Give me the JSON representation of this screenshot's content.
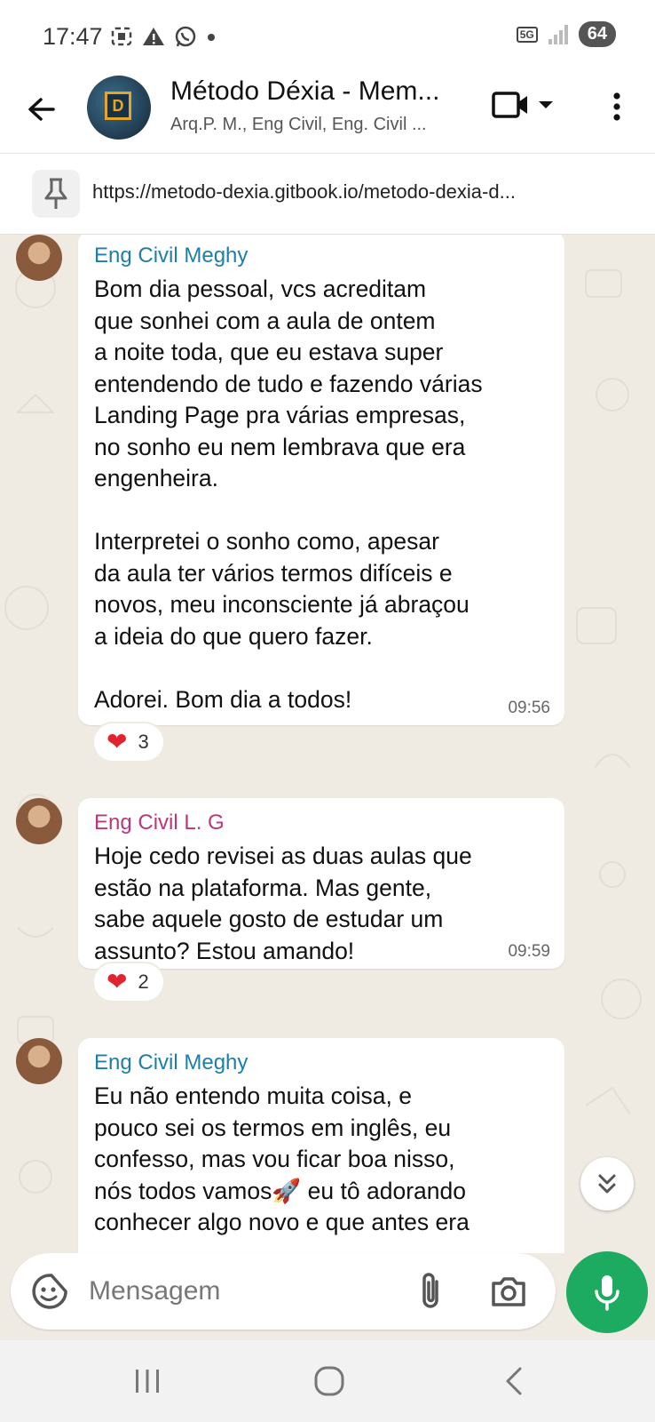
{
  "status_bar": {
    "time": "17:47",
    "network": "5G",
    "battery": "64"
  },
  "header": {
    "title": "Método Déxia - Mem...",
    "subtitle": "Arq.P. M., Eng Civil, Eng. Civil ...",
    "avatar_letter": "D",
    "icons": [
      "back-arrow-icon",
      "video-call-icon",
      "dropdown-caret-icon",
      "more-vert-icon"
    ]
  },
  "pinned": {
    "text": "https://metodo-dexia.gitbook.io/metodo-dexia-d..."
  },
  "messages": [
    {
      "sender": "Eng Civil Meghy",
      "text": "Bom dia pessoal, vcs acreditam\nque sonhei com a aula de ontem\na noite toda, que eu estava super\nentendendo de tudo e fazendo várias\nLanding Page pra várias empresas,\nno sonho eu nem lembrava que era\nengenheira.\n\nInterpretei o sonho como, apesar\nda aula ter vários termos difíceis e\nnovos, meu inconsciente já abraçou\na ideia do que quero fazer.\n\nAdorei. Bom dia a todos!",
      "time": "09:56",
      "reaction_count": "3"
    },
    {
      "sender": "Eng Civil L. G",
      "text": "Hoje cedo revisei as duas aulas que\nestão na plataforma. Mas gente,\nsabe aquele gosto de estudar um\nassunto? Estou amando!",
      "time": "09:59",
      "reaction_count": "2"
    },
    {
      "sender": "Eng Civil Meghy",
      "text": "Eu não entendo muita coisa, e\npouco sei os termos em inglês, eu\nconfesso, mas vou ficar boa nisso,\nnós todos vamos🚀 eu tô adorando\nconhecer algo novo e que antes era"
    }
  ],
  "composer": {
    "placeholder": "Mensagem"
  },
  "colors": {
    "accent_green": "#1daa61",
    "sender_blue": "#1f7ea8",
    "sender_pink": "#c0357a",
    "chat_bg": "#efeae2"
  }
}
